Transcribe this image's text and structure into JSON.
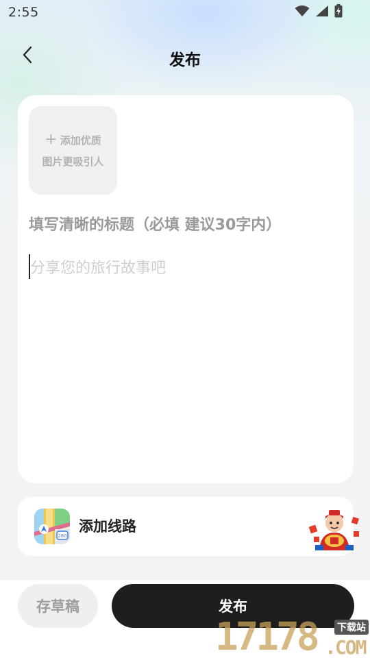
{
  "status_bar": {
    "time": "2:55",
    "icons": [
      "wifi-icon",
      "cellular-signal-icon",
      "battery-charging-icon"
    ]
  },
  "nav": {
    "back_icon": "chevron-left-icon",
    "title": "发布"
  },
  "editor": {
    "add_image_line1": "添加优质",
    "add_image_line2": "图片更吸引人",
    "title_placeholder": "填写清晰的标题（必填  建议30字内）",
    "content_placeholder": "分享您的旅行故事吧"
  },
  "route": {
    "label": "添加线路",
    "icon": "map-route-icon",
    "decoration": "mascot-sticker"
  },
  "actions": {
    "draft_label": "存草稿",
    "publish_label": "发布"
  },
  "watermark": {
    "number": "17178",
    "tag": "下载站",
    "suffix": ".COM"
  },
  "colors": {
    "publish_button": "#1e1e1e",
    "draft_button": "#efefef",
    "card_background": "#ffffff",
    "page_background": "#f3f3f3"
  }
}
